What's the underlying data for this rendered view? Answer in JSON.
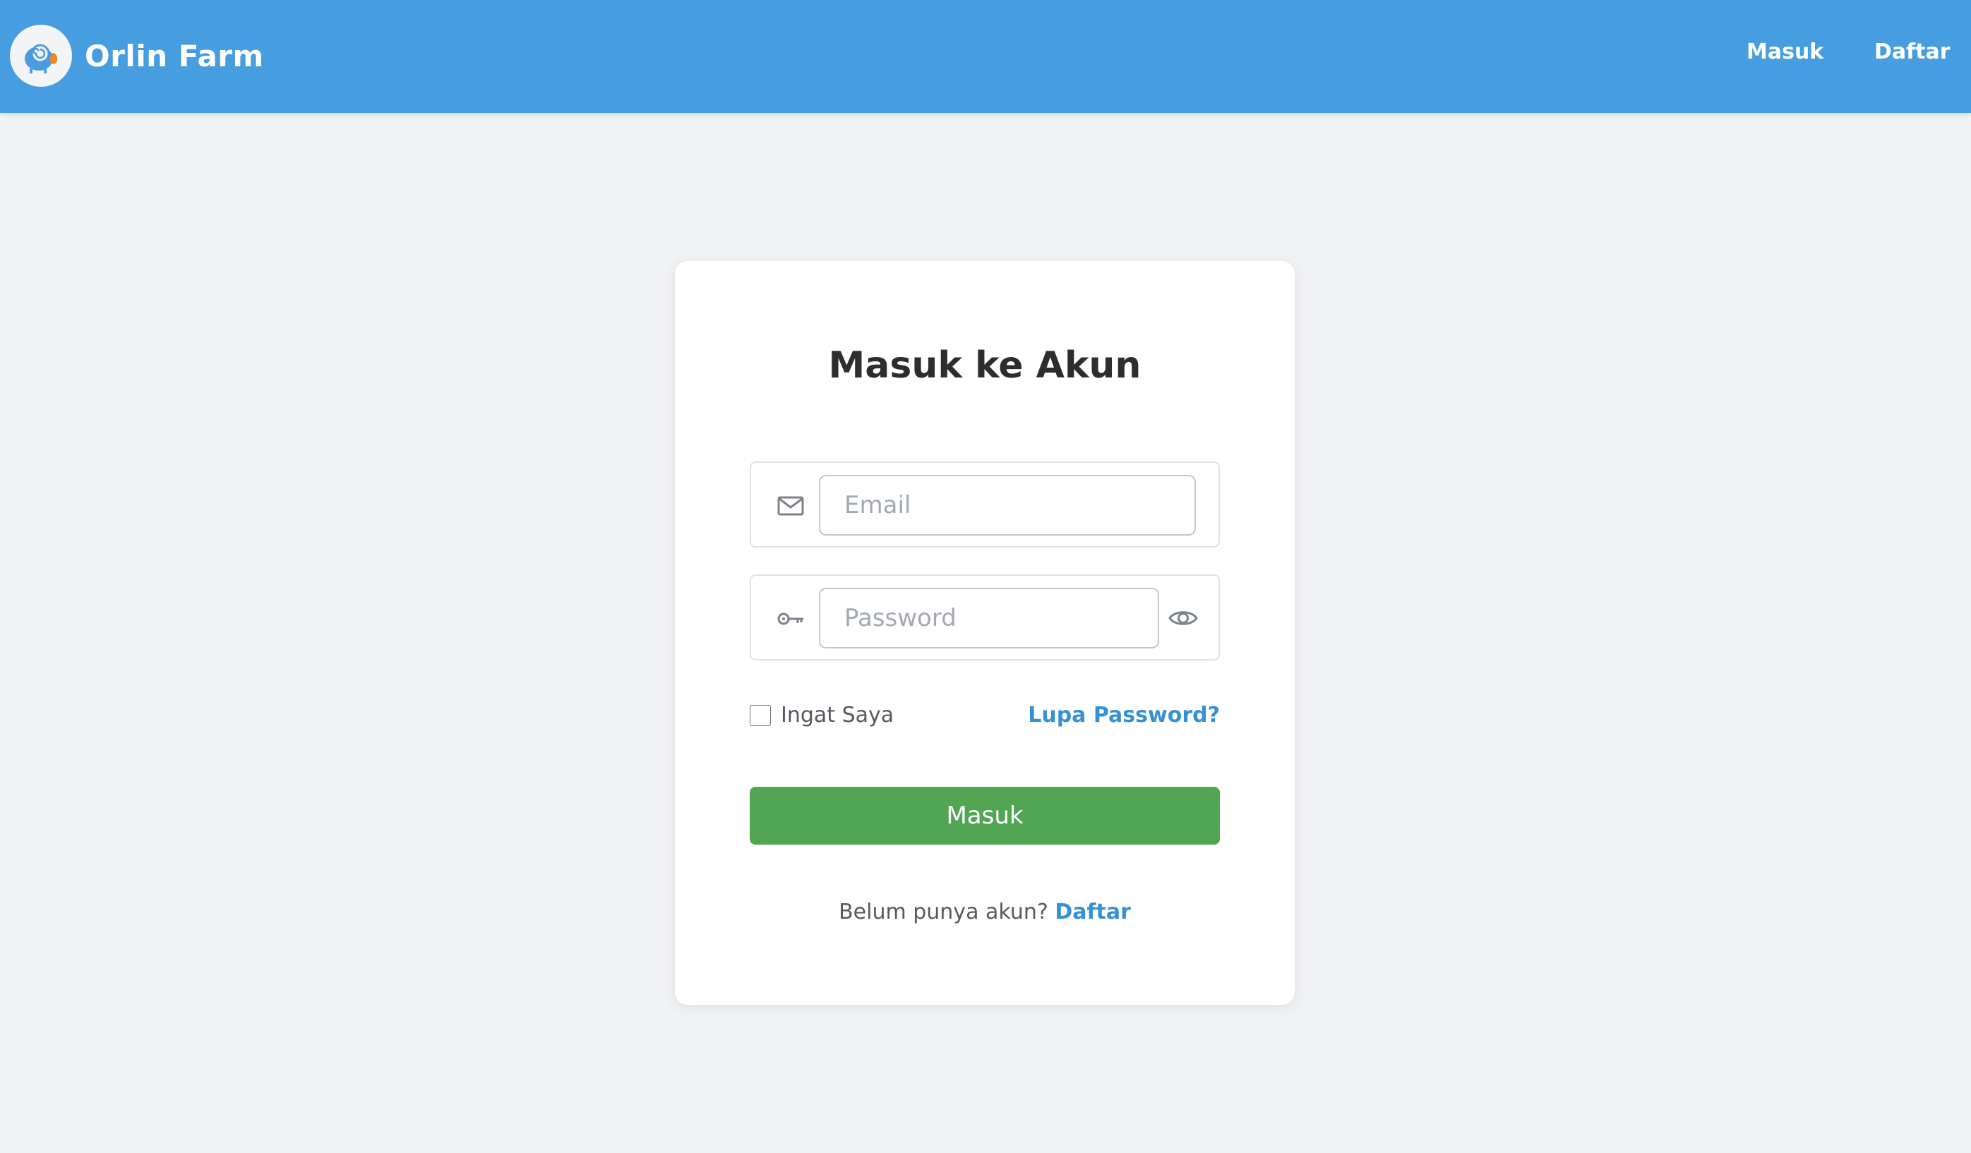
{
  "navbar": {
    "brand_name": "Orlin Farm",
    "logo_icon": "sheep-logo-icon",
    "links": {
      "login": "Masuk",
      "register": "Daftar"
    },
    "background_color": "#469ddf"
  },
  "login_card": {
    "title": "Masuk ke Akun",
    "email": {
      "icon": "mail-icon",
      "placeholder": "Email",
      "value": ""
    },
    "password": {
      "icon": "key-icon",
      "placeholder": "Password",
      "value": "",
      "toggle_icon": "eye-icon"
    },
    "remember_label": "Ingat Saya",
    "remember_checked": false,
    "forgot_label": "Lupa Password?",
    "submit_label": "Masuk",
    "no_account_text": "Belum punya akun?",
    "register_label": "Daftar"
  },
  "colors": {
    "accent": "#3691d4",
    "button": "#52a552",
    "page_background": "#f1f2f4"
  }
}
